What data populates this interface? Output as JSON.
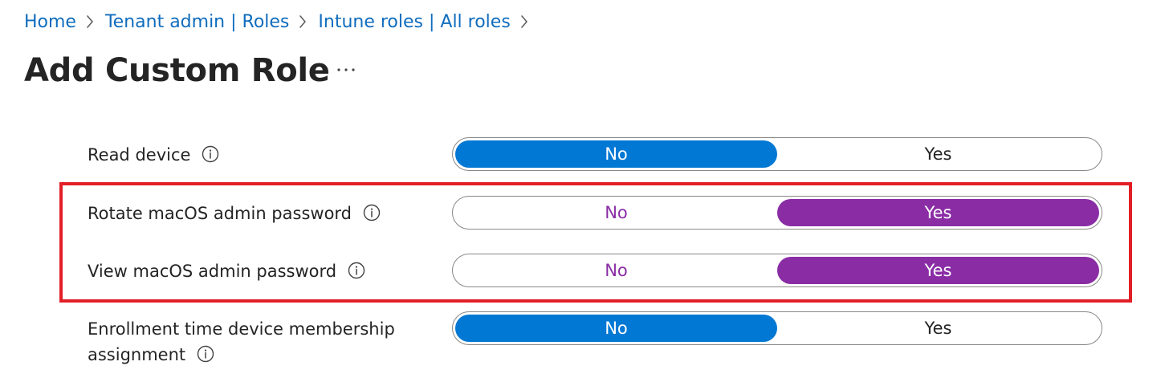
{
  "breadcrumb": {
    "items": [
      "Home",
      "Tenant admin | Roles",
      "Intune roles | All roles"
    ]
  },
  "page": {
    "title": "Add Custom Role",
    "more_label": "···"
  },
  "settings": [
    {
      "label": "Read device",
      "options": [
        "No",
        "Yes"
      ],
      "selected": "No"
    },
    {
      "label": "Rotate macOS admin password",
      "options": [
        "No",
        "Yes"
      ],
      "selected": "Yes"
    },
    {
      "label": "View macOS admin password",
      "options": [
        "No",
        "Yes"
      ],
      "selected": "Yes"
    },
    {
      "label_line1": "Enrollment time device membership",
      "label_line2": "assignment",
      "options": [
        "No",
        "Yes"
      ],
      "selected": "No"
    }
  ],
  "colors": {
    "link": "#0f6cbd",
    "toggle_blue": "#0078d4",
    "toggle_purple": "#8a2da5",
    "highlight_red": "#e21f26"
  },
  "icons": {
    "separator": "chevron-right-icon",
    "info": "info-icon",
    "more": "more-horizontal-icon"
  }
}
